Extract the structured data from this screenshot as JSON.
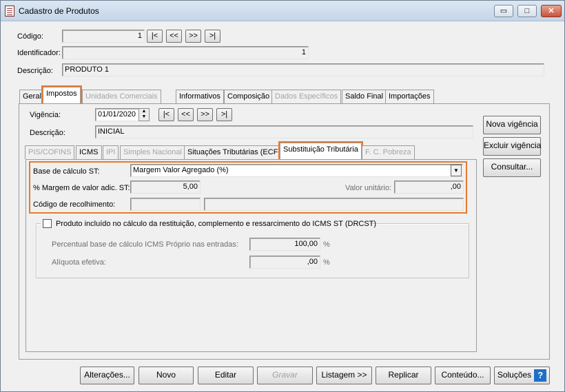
{
  "window": {
    "title": "Cadastro de Produtos",
    "minimize": "▭",
    "maximize": "□",
    "close": "✕"
  },
  "header": {
    "codigo_label": "Código:",
    "codigo_value": "1",
    "identificador_label": "Identificador:",
    "identificador_value": "1",
    "descricao_label": "Descrição:",
    "descricao_value": "PRODUTO 1",
    "nav": [
      "|<",
      "<<",
      ">>",
      ">|"
    ]
  },
  "tabs": [
    "Geral",
    "Impostos",
    "Unidades Comerciais",
    "Informativos",
    "Composição",
    "Dados Específicos",
    "Saldo Final",
    "Importações"
  ],
  "impostos": {
    "vigencia_label": "Vigência:",
    "vigencia_value": "01/01/2020",
    "spin_up": "▲",
    "spin_down": "▼",
    "nav": [
      "|<",
      "<<",
      ">>",
      ">|"
    ],
    "descricao_label": "Descrição:",
    "descricao_value": "INICIAL",
    "side_buttons": [
      "Nova vigência",
      "Excluir vigência",
      "Consultar..."
    ],
    "subtabs": [
      "PIS/COFINS",
      "ICMS",
      "IPI",
      "Simples Nacional",
      "Situações Tributárias (ECF)",
      "Substituição Tributária",
      "F. C. Pobreza"
    ]
  },
  "st": {
    "base_label": "Base de cálculo ST:",
    "base_value": "Margem Valor Agregado (%)",
    "dropdown_glyph": "▼",
    "margem_label": "% Margem de valor adic. ST:",
    "margem_value": "5,00",
    "valor_unit_label": "Valor unitário:",
    "valor_unit_value": ",00",
    "codigo_recolh_label": "Código de recolhimento:",
    "codigo_recolh_value": "",
    "codigo_recolh_desc": ""
  },
  "drcst": {
    "checkbox_label": "Produto incluído no cálculo da restituição, complemento e ressarcimento do ICMS ST (DRCST)",
    "percentual_label": "Percentual base de cálculo ICMS Próprio nas entradas:",
    "percentual_value": "100,00",
    "aliquota_label": "Alíquota efetiva:",
    "aliquota_value": ",00",
    "percent_sign": "%"
  },
  "footer": {
    "buttons": [
      "Alterações...",
      "Novo",
      "Editar",
      "Gravar",
      "Listagem >>",
      "Replicar",
      "Conteúdo..."
    ],
    "solucoes_label": "Soluções",
    "help_glyph": "?"
  },
  "colors": {
    "highlight": "#e8792e",
    "help_icon": "#1f6fc6"
  }
}
